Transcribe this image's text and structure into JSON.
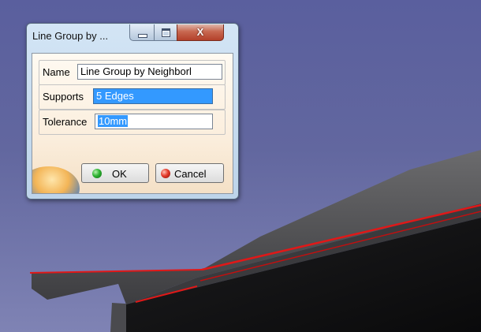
{
  "dialog": {
    "title": "Line Group by ...",
    "fields": {
      "name_label": "Name",
      "name_value": "Line Group by Neighborl",
      "supports_label": "Supports",
      "supports_value": "5 Edges",
      "tolerance_label": "Tolerance",
      "tolerance_value": "10mm"
    },
    "buttons": {
      "ok_label": "OK",
      "cancel_label": "Cancel"
    },
    "window_controls": {
      "close_glyph": "X"
    }
  },
  "colors": {
    "viewport_background": "#5f639f",
    "highlight_edges": "#e01818",
    "selection": "#3399ff"
  }
}
